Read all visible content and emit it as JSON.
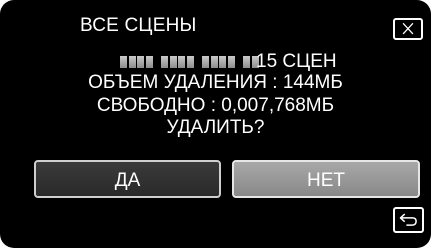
{
  "dialog": {
    "title": "ВСЕ СЦЕНЫ",
    "close_icon": "close-x-icon",
    "scene_count_text": "15 СЦЕН",
    "delete_volume": "ОБЪЕМ УДАЛЕНИЯ : 144МБ",
    "free_space": "СВОБОДНО : 0,007,768МБ",
    "question": "УДАЛИТЬ?"
  },
  "buttons": {
    "yes_label": "ДА",
    "no_label": "НЕТ"
  },
  "back_icon": "return-arrow-icon",
  "colors": {
    "background": "#000000",
    "text": "#ffffff",
    "selected_button": "#999999"
  }
}
